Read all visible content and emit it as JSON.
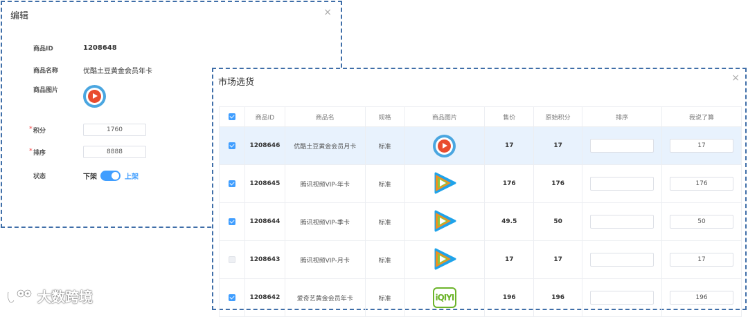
{
  "edit": {
    "title": "编辑",
    "close": "×",
    "fields": {
      "id_label": "商品ID",
      "id_value": "1208648",
      "name_label": "商品名称",
      "name_value": "优酷土豆黄金会员年卡",
      "image_label": "商品图片",
      "points_label": "积分",
      "points_value": "1760",
      "sort_label": "排序",
      "sort_value": "8888",
      "status_label": "状态",
      "status_off": "下架",
      "status_on": "上架",
      "required_mark": "*"
    }
  },
  "market": {
    "title": "市场选货",
    "close": "×",
    "columns": [
      "商品ID",
      "商品名",
      "规格",
      "商品图片",
      "售价",
      "原始积分",
      "排序",
      "我说了算"
    ],
    "rows": [
      {
        "checked": true,
        "id": "1208646",
        "name": "优酷土豆黄金会员月卡",
        "spec": "标准",
        "icon": "youku-icon",
        "price": "17",
        "points": "17",
        "sort": "",
        "custom": "17",
        "selected": true
      },
      {
        "checked": true,
        "id": "1208645",
        "name": "腾讯视频VIP-年卡",
        "spec": "标准",
        "icon": "tencent-video-icon",
        "price": "176",
        "points": "176",
        "sort": "",
        "custom": "176",
        "selected": false
      },
      {
        "checked": true,
        "id": "1208644",
        "name": "腾讯视频VIP-季卡",
        "spec": "标准",
        "icon": "tencent-video-icon",
        "price": "49.5",
        "points": "50",
        "sort": "",
        "custom": "50",
        "selected": false
      },
      {
        "checked": false,
        "id": "1208643",
        "name": "腾讯视频VIP-月卡",
        "spec": "标准",
        "icon": "tencent-video-icon",
        "price": "17",
        "points": "17",
        "sort": "",
        "custom": "17",
        "selected": false
      },
      {
        "checked": true,
        "id": "1208642",
        "name": "爱奇艺黄金会员年卡",
        "spec": "标准",
        "icon": "iqiyi-icon",
        "price": "196",
        "points": "196",
        "sort": "",
        "custom": "196",
        "selected": false
      }
    ],
    "iqiyi_text": "iQIYI"
  },
  "watermark": {
    "text": "大数跨境"
  },
  "colors": {
    "accent": "#409eff",
    "border_dash": "#3f6ea8",
    "required": "#f56c6c"
  }
}
